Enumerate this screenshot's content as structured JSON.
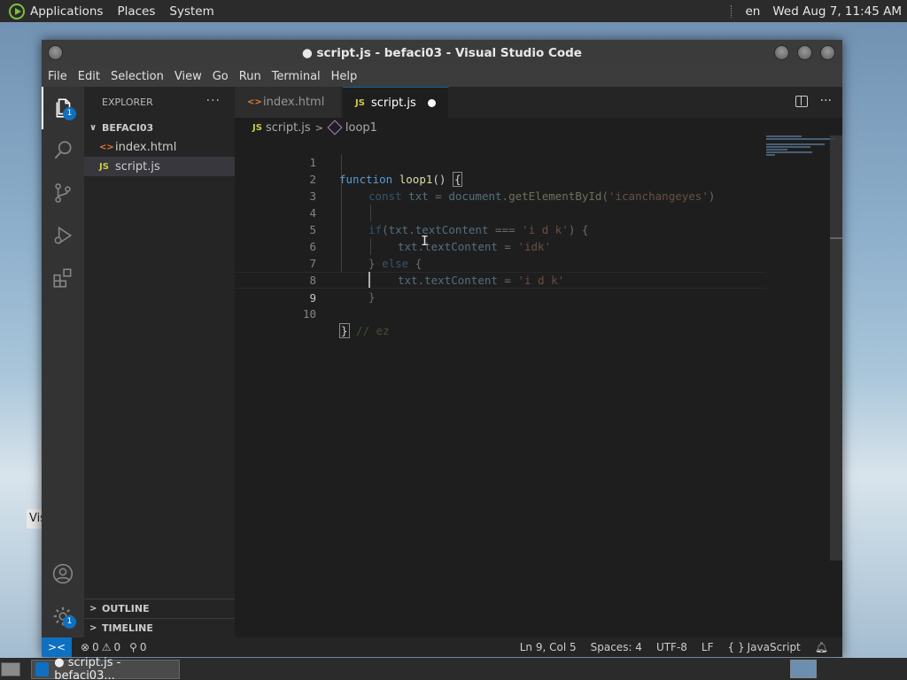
{
  "top_panel": {
    "menus": [
      "Applications",
      "Places",
      "System"
    ],
    "lang": "en",
    "clock": "Wed Aug  7, 11:45 AM"
  },
  "window": {
    "title": "● script.js - befaci03 - Visual Studio Code",
    "menu": [
      "File",
      "Edit",
      "Selection",
      "View",
      "Go",
      "Run",
      "Terminal",
      "Help"
    ]
  },
  "activity": {
    "explorer_badge": "1",
    "settings_badge": "1"
  },
  "sidebar": {
    "title": "EXPLORER",
    "more": "···",
    "folder": "BEFACI03",
    "files": [
      {
        "icon": "<>",
        "name": "index.html"
      },
      {
        "icon": "JS",
        "name": "script.js"
      }
    ],
    "outline": "OUTLINE",
    "timeline": "TIMELINE"
  },
  "tabs": [
    {
      "icon": "<>",
      "label": "index.html"
    },
    {
      "icon": "JS",
      "label": "script.js"
    }
  ],
  "tab_actions": {
    "more": "···"
  },
  "breadcrumb": {
    "file_icon": "JS",
    "file": "script.js",
    "separator": ">",
    "symbol": "loop1"
  },
  "code": {
    "line_numbers": [
      "1",
      "2",
      "3",
      "4",
      "5",
      "6",
      "7",
      "8",
      "9",
      "10"
    ],
    "l1": {
      "kw": "function",
      "name": " loop1",
      "rest": "() ",
      "brace": "{"
    },
    "l2": {
      "kw": "const",
      "var": " txt",
      "eq": " = ",
      "obj": "document",
      "dot": ".",
      "fn": "getElementById",
      "open": "(",
      "str": "'icanchangeyes'",
      "close": ")"
    },
    "l4": {
      "kw": "if",
      "open": "(",
      "var": "txt",
      "dot": ".",
      "prop": "textContent",
      "op": " === ",
      "str": "'i d k'",
      "close": ") {"
    },
    "l5": {
      "var": "txt",
      "dot": ".",
      "prop": "textContent",
      "op": " = ",
      "str": "'idk'"
    },
    "l6": {
      "close": "} ",
      "kw": "else",
      "open": " {"
    },
    "l7": {
      "var": "txt",
      "dot": ".",
      "prop": "textContent",
      "op": " = ",
      "str": "'i d k'"
    },
    "l8": {
      "close": "}"
    },
    "l10": {
      "brace": "}",
      "comment": " // ez"
    }
  },
  "status": {
    "remote": "><",
    "errors": "0",
    "warnings": "0",
    "ports": "0",
    "position": "Ln 9, Col 5",
    "spaces": "Spaces: 4",
    "encoding": "UTF-8",
    "eol": "LF",
    "lang_brackets": "{ }",
    "language": "JavaScript"
  },
  "taskbar": {
    "task_label": "● script.js - befaci03..."
  },
  "desktop": {
    "tip_fragment": "Vis"
  }
}
